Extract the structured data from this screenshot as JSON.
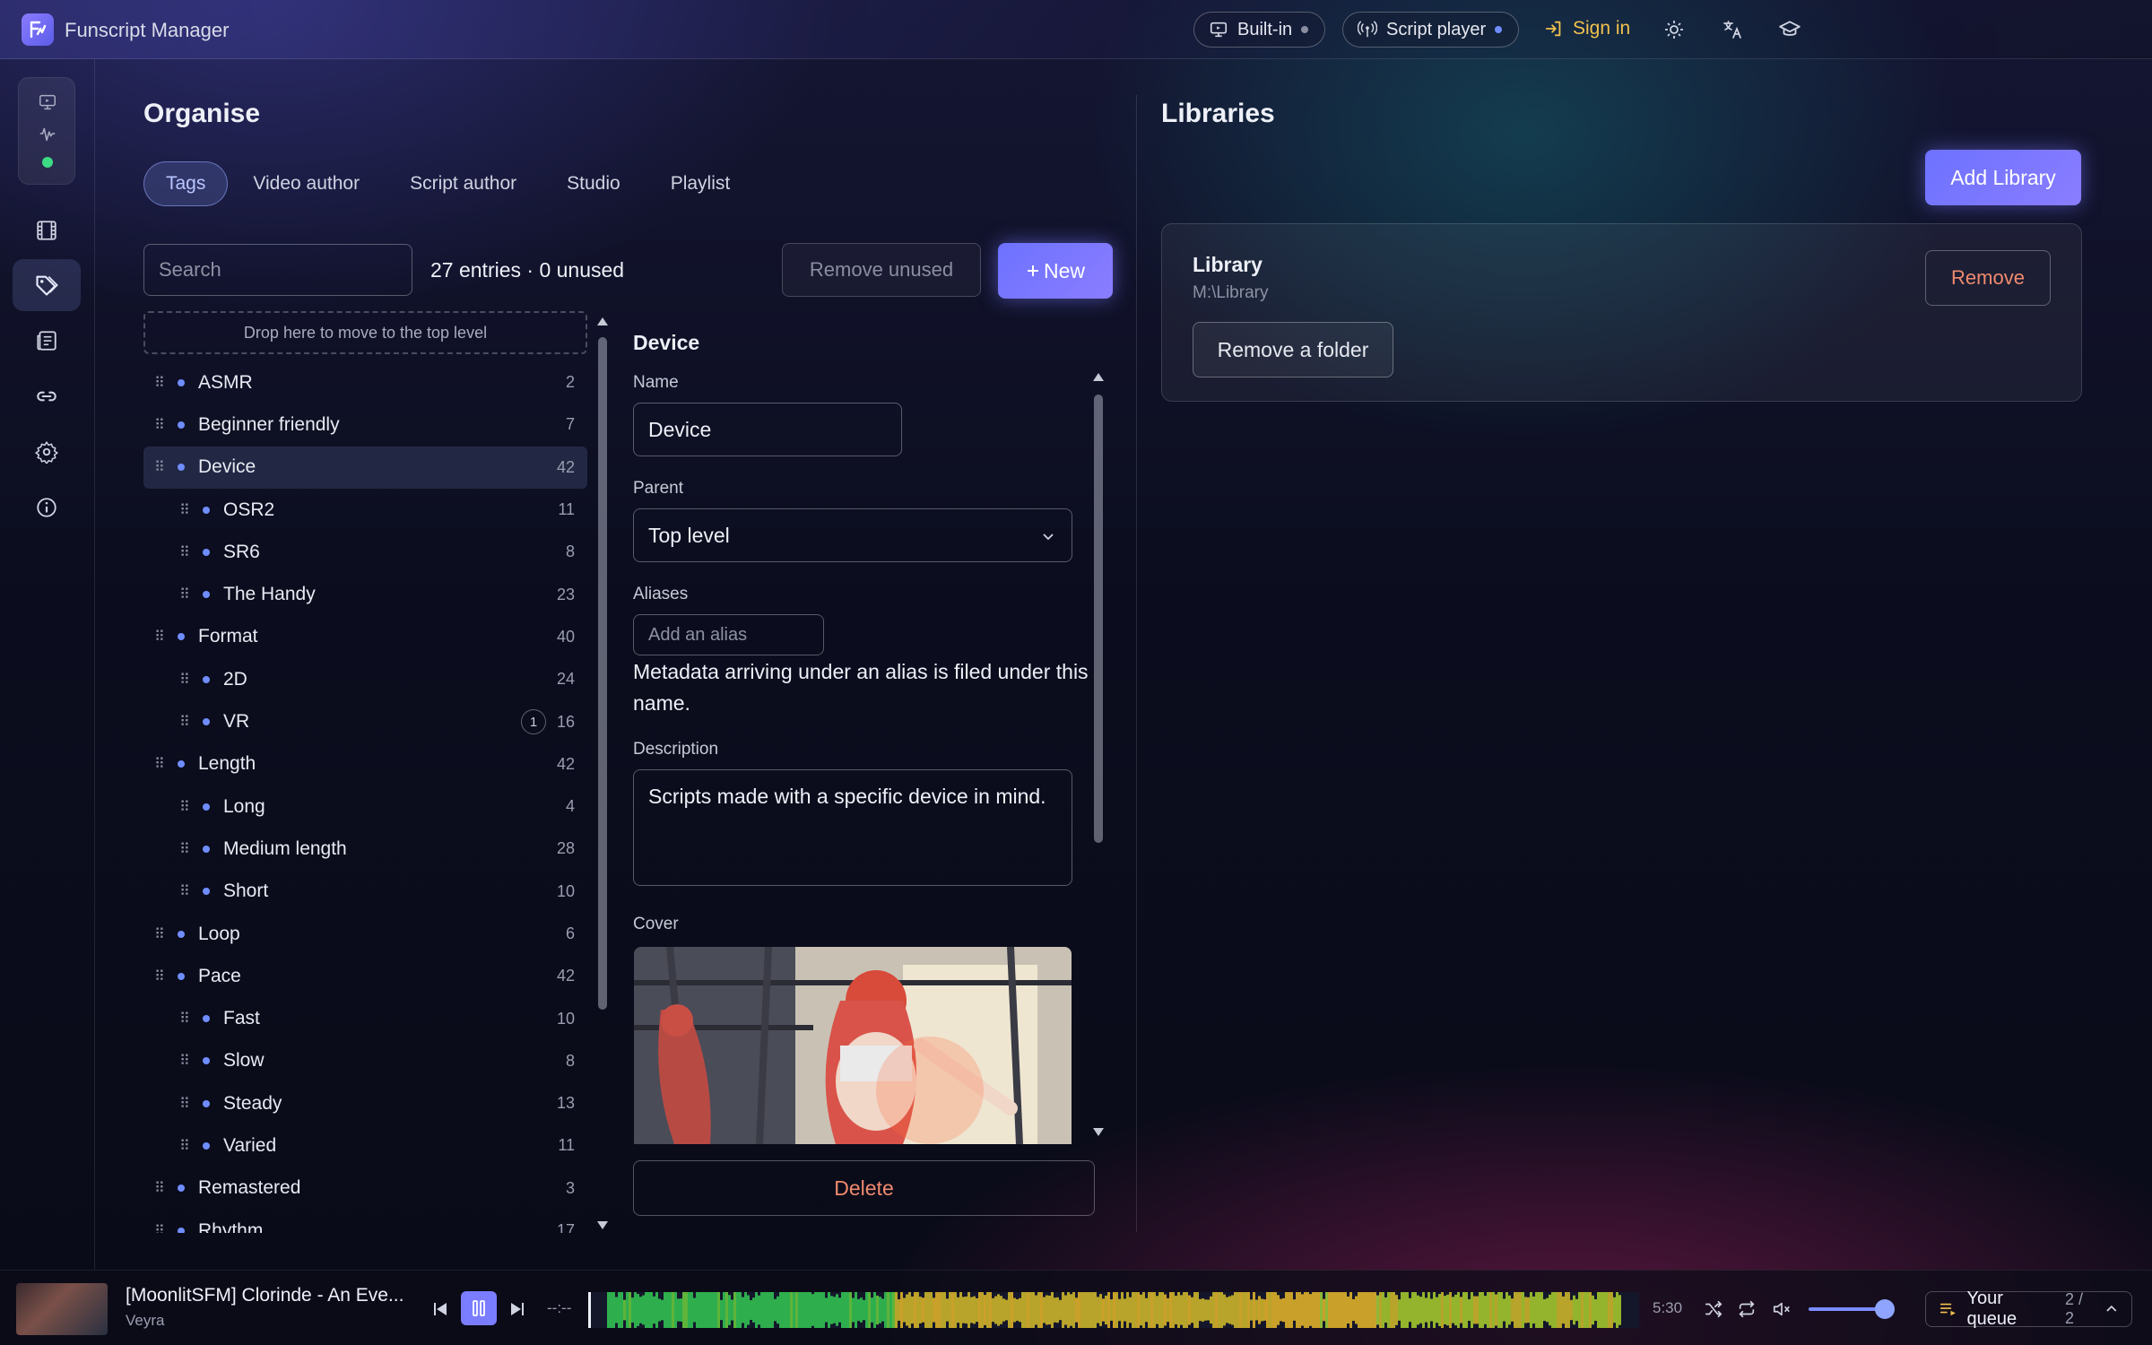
{
  "app": {
    "title": "Funscript Manager"
  },
  "topbar": {
    "built_in_label": "Built-in",
    "script_player_label": "Script player",
    "sign_in_label": "Sign in"
  },
  "organise": {
    "title": "Organise",
    "tabs": [
      {
        "label": "Tags",
        "active": true
      },
      {
        "label": "Video author",
        "active": false
      },
      {
        "label": "Script author",
        "active": false
      },
      {
        "label": "Studio",
        "active": false
      },
      {
        "label": "Playlist",
        "active": false
      }
    ],
    "search_placeholder": "Search",
    "entries_text": "27 entries · 0 unused",
    "remove_unused_label": "Remove unused",
    "new_label": "New",
    "drop_zone_text": "Drop here to move to the top level",
    "tags": [
      {
        "label": "ASMR",
        "count": "2",
        "level": 0
      },
      {
        "label": "Beginner friendly",
        "count": "7",
        "level": 0
      },
      {
        "label": "Device",
        "count": "42",
        "level": 0,
        "selected": true
      },
      {
        "label": "OSR2",
        "count": "11",
        "level": 1
      },
      {
        "label": "SR6",
        "count": "8",
        "level": 1
      },
      {
        "label": "The Handy",
        "count": "23",
        "level": 1
      },
      {
        "label": "Format",
        "count": "40",
        "level": 0
      },
      {
        "label": "2D",
        "count": "24",
        "level": 1
      },
      {
        "label": "VR",
        "count": "16",
        "level": 1,
        "badge": "1"
      },
      {
        "label": "Length",
        "count": "42",
        "level": 0
      },
      {
        "label": "Long",
        "count": "4",
        "level": 1
      },
      {
        "label": "Medium length",
        "count": "28",
        "level": 1
      },
      {
        "label": "Short",
        "count": "10",
        "level": 1
      },
      {
        "label": "Loop",
        "count": "6",
        "level": 0
      },
      {
        "label": "Pace",
        "count": "42",
        "level": 0
      },
      {
        "label": "Fast",
        "count": "10",
        "level": 1
      },
      {
        "label": "Slow",
        "count": "8",
        "level": 1
      },
      {
        "label": "Steady",
        "count": "13",
        "level": 1
      },
      {
        "label": "Varied",
        "count": "11",
        "level": 1
      },
      {
        "label": "Remastered",
        "count": "3",
        "level": 0
      },
      {
        "label": "Rhythm",
        "count": "17",
        "level": 0
      }
    ]
  },
  "detail": {
    "title": "Device",
    "name_label": "Name",
    "name_value": "Device",
    "parent_label": "Parent",
    "parent_value": "Top level",
    "aliases_label": "Aliases",
    "alias_placeholder": "Add an alias",
    "alias_help": "Metadata arriving under an alias is filed under this name.",
    "description_label": "Description",
    "description_value": "Scripts made with a specific device in mind.",
    "cover_label": "Cover",
    "delete_label": "Delete"
  },
  "libraries": {
    "title": "Libraries",
    "add_label": "Add Library",
    "items": [
      {
        "name": "Library",
        "path": "M:\\Library",
        "remove_label": "Remove",
        "remove_folder_label": "Remove a folder"
      }
    ]
  },
  "player": {
    "title": "[MoonlitSFM] Clorinde - An Eve...",
    "artist": "Veyra",
    "elapsed": "--:--",
    "duration": "5:30",
    "queue_label": "Your queue",
    "queue_count": "2 / 2",
    "volume": 0.85
  },
  "colors": {
    "accent": "#7a7dff",
    "danger": "#f08a6e",
    "warning": "#f2c14e",
    "online": "#3ddc84"
  }
}
